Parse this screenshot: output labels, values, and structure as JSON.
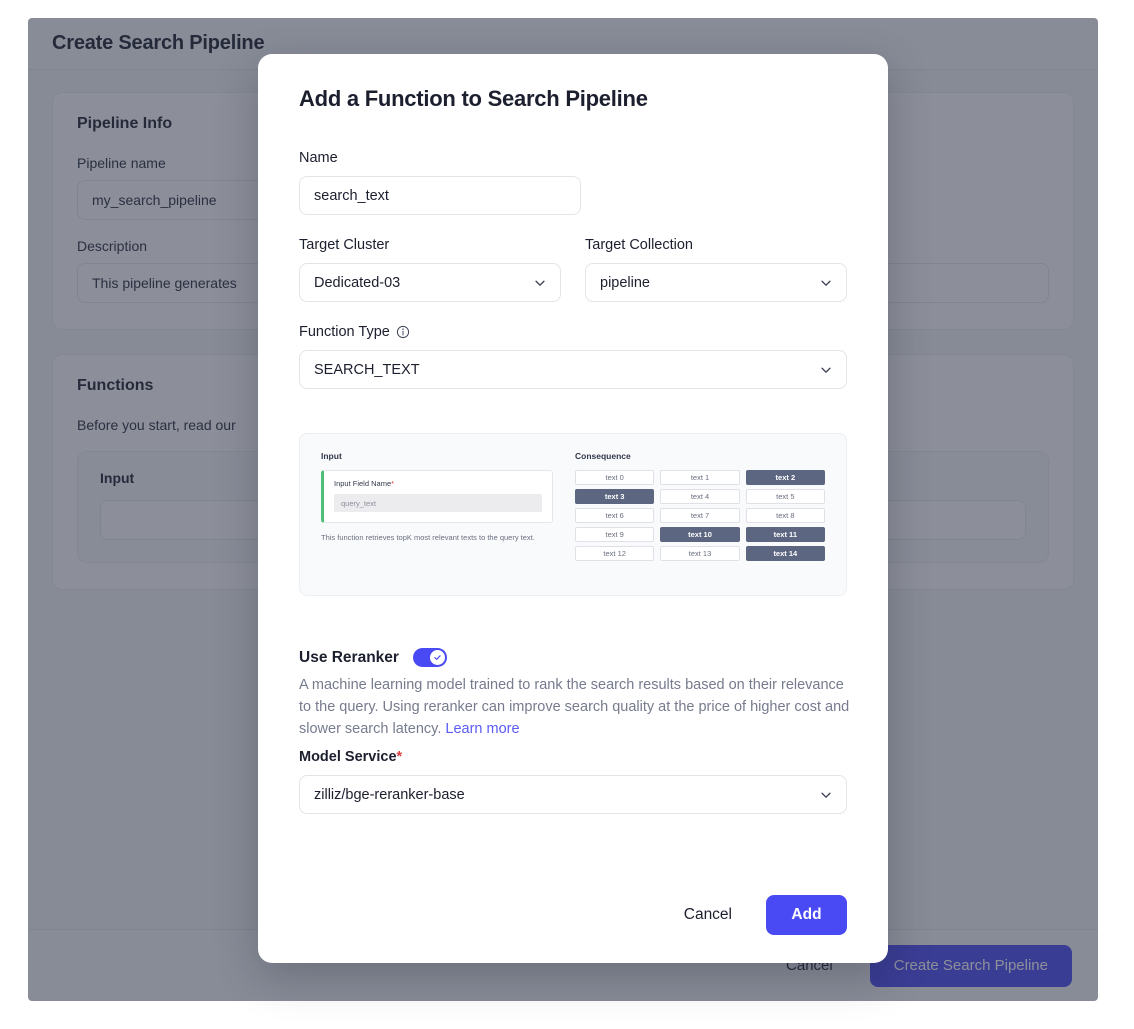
{
  "background": {
    "header_title": "Create Search Pipeline",
    "pipeline_info": {
      "title": "Pipeline Info",
      "name_label": "Pipeline name",
      "name_value": "my_search_pipeline",
      "description_label": "Description",
      "description_value": "This pipeline generates"
    },
    "functions": {
      "title": "Functions",
      "hint": "Before you start, read our",
      "input_title": "Input"
    },
    "footer": {
      "cancel_label": "Cancel",
      "create_label": "Create Search Pipeline"
    }
  },
  "modal": {
    "title": "Add a Function to Search Pipeline",
    "name": {
      "label": "Name",
      "value": "search_text"
    },
    "target_cluster": {
      "label": "Target Cluster",
      "value": "Dedicated-03"
    },
    "target_collection": {
      "label": "Target Collection",
      "value": "pipeline"
    },
    "function_type": {
      "label": "Function Type",
      "value": "SEARCH_TEXT"
    },
    "diagram": {
      "input_heading": "Input",
      "input_field_label": "Input Field Name",
      "input_field_required": "*",
      "input_field_value": "query_text",
      "note": "This function retrieves topK most relevant texts to the query text.",
      "consequence_heading": "Consequence",
      "chips": [
        {
          "label": "text 0",
          "highlighted": false
        },
        {
          "label": "text 1",
          "highlighted": false
        },
        {
          "label": "text 2",
          "highlighted": true
        },
        {
          "label": "text 3",
          "highlighted": true
        },
        {
          "label": "text 4",
          "highlighted": false
        },
        {
          "label": "text 5",
          "highlighted": false
        },
        {
          "label": "text 6",
          "highlighted": false
        },
        {
          "label": "text 7",
          "highlighted": false
        },
        {
          "label": "text 8",
          "highlighted": false
        },
        {
          "label": "text 9",
          "highlighted": false
        },
        {
          "label": "text 10",
          "highlighted": true
        },
        {
          "label": "text 11",
          "highlighted": true
        },
        {
          "label": "text 12",
          "highlighted": false
        },
        {
          "label": "text 13",
          "highlighted": false
        },
        {
          "label": "text 14",
          "highlighted": true
        }
      ]
    },
    "reranker": {
      "title": "Use Reranker",
      "enabled": true,
      "description": "A machine learning model trained to rank the search results based on their relevance to the query. Using reranker can improve search quality at the price of higher cost and slower search latency. ",
      "link_label": "Learn more",
      "model_label": "Model Service",
      "model_required": "*",
      "model_value": "zilliz/bge-reranker-base"
    },
    "footer": {
      "cancel_label": "Cancel",
      "add_label": "Add"
    }
  },
  "colors": {
    "accent": "#4a4af4",
    "chip_on": "#5c6680",
    "green_accent": "#4fbe79",
    "required_red": "#e03c3c",
    "link": "#5b5bf5"
  }
}
